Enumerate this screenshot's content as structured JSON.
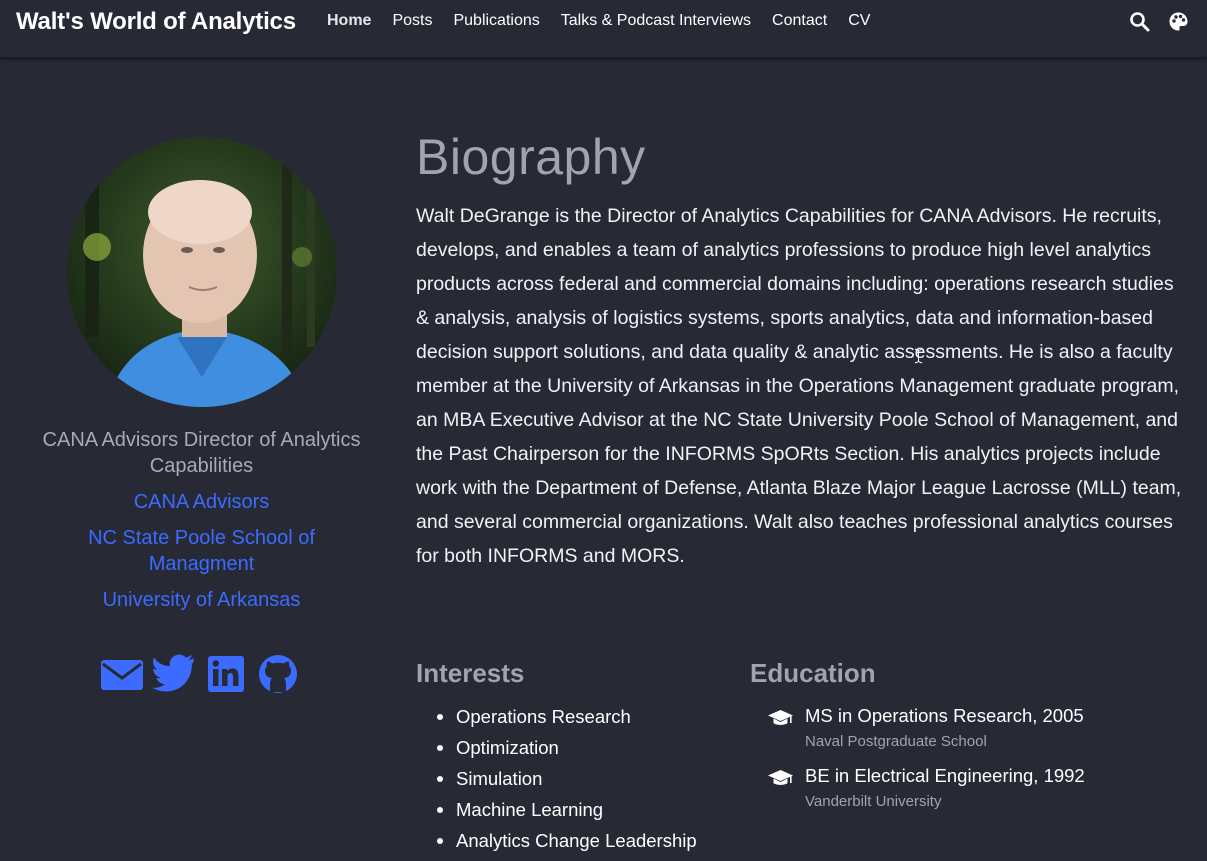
{
  "header": {
    "brand": "Walt's World of Analytics",
    "nav": [
      {
        "label": "Home",
        "active": true
      },
      {
        "label": "Posts"
      },
      {
        "label": "Publications"
      },
      {
        "label": "Talks & Podcast Interviews"
      },
      {
        "label": "Contact"
      },
      {
        "label": "CV"
      }
    ],
    "icons": [
      "search-icon",
      "palette-icon"
    ]
  },
  "profile": {
    "role": "CANA Advisors Director of Analytics Capabilities",
    "orgs": [
      "CANA Advisors",
      "NC State Poole School of Managment",
      "University of Arkansas"
    ],
    "socials": [
      "email-icon",
      "twitter-icon",
      "linkedin-icon",
      "github-icon"
    ]
  },
  "biography": {
    "title": "Biography",
    "text": "Walt DeGrange is the Director of Analytics Capabilities for CANA Advisors. He recruits, develops, and enables a team of analytics professions to produce high level analytics products across federal and commercial domains including: operations research studies & analysis, analysis of logistics systems, sports analytics, data and information-based decision support solutions, and data quality & analytic assessments. He is also a faculty member at the University of Arkansas in the Operations Management graduate program, an MBA Executive Advisor at the NC State University Poole School of Management, and the Past Chairperson for the INFORMS SpORts Section. His analytics projects include work with the Department of Defense, Atlanta Blaze Major League Lacrosse (MLL) team, and several commercial organizations. Walt also teaches professional analytics courses for both INFORMS and MORS."
  },
  "interests": {
    "title": "Interests",
    "items": [
      "Operations Research",
      "Optimization",
      "Simulation",
      "Machine Learning",
      "Analytics Change Leadership"
    ]
  },
  "education": {
    "title": "Education",
    "items": [
      {
        "degree": "MS in Operations Research, 2005",
        "school": "Naval Postgraduate School"
      },
      {
        "degree": "BE in Electrical Engineering, 1992",
        "school": "Vanderbilt University"
      }
    ]
  },
  "colors": {
    "background": "#272935",
    "accent": "#3b6bff",
    "muted": "#a0a4ab"
  }
}
